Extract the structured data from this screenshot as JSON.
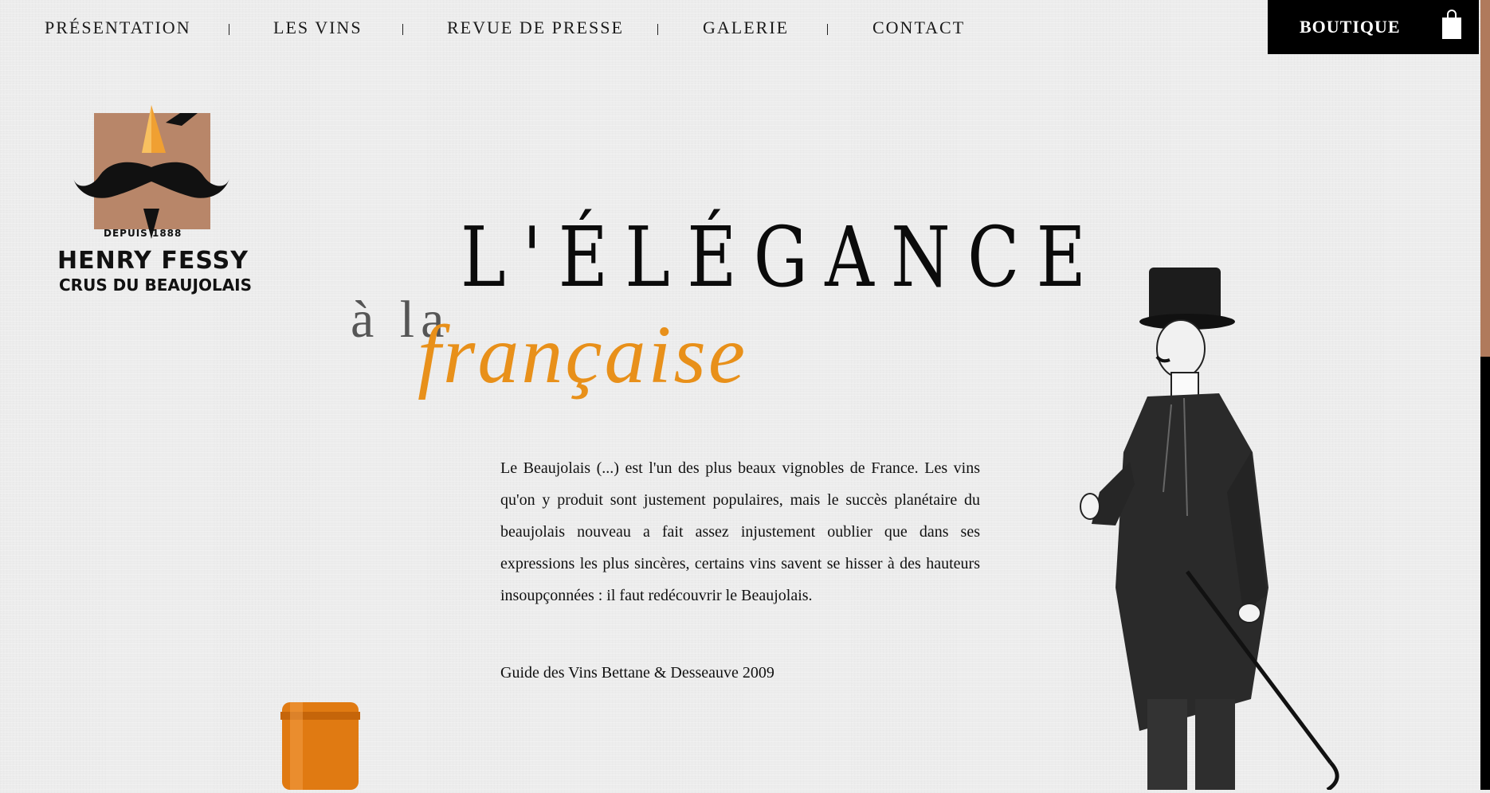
{
  "nav": {
    "items": [
      "PRÉSENTATION",
      "LES VINS",
      "REVUE DE PRESSE",
      "GALERIE",
      "CONTACT"
    ],
    "boutique_label": "BOUTIQUE"
  },
  "logo": {
    "depuis": "DEPUIS 1888",
    "name": "HENRY FESSY",
    "subtitle": "CRUS DU BEAUJOLAIS"
  },
  "hero": {
    "headline": "L'ÉLÉGANCE",
    "sub_a": "à la",
    "sub_b": "française"
  },
  "quote": {
    "text": "Le Beaujolais (...) est l'un des plus beaux vignobles de France. Les vins qu'on y produit sont justement populaires, mais le succès planétaire du beaujolais nouveau a fait assez injustement oublier que dans ses expressions les plus sincères, certains vins savent se hisser à des hauteurs insoupçonnées : il faut redécouvrir le Beaujolais.",
    "citation": "Guide des Vins Bettane & Desseauve 2009"
  },
  "colors": {
    "accent": "#e8901a",
    "logo_square": "#b88669",
    "edge_brown": "#b07a5c"
  },
  "icons": {
    "boutique": "shopping-bag-icon"
  }
}
